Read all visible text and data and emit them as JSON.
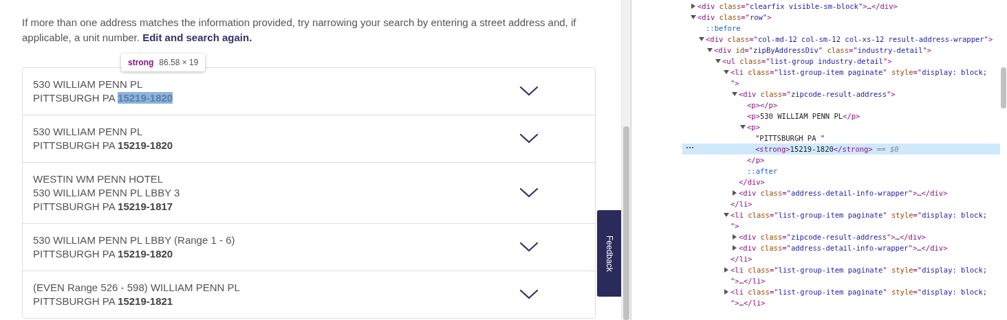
{
  "intro": {
    "text": "If more than one address matches the information provided, try narrowing your search by entering a street address and, if applicable, a unit number.",
    "link": "Edit and search again."
  },
  "inspector_tooltip": {
    "tag": "strong",
    "size": "86.58 × 19"
  },
  "results": [
    {
      "lines": [
        "530 WILLIAM PENN PL"
      ],
      "city": "PITTSBURGH PA",
      "zip": "15219-1820",
      "highlighted": true,
      "expanded": false
    },
    {
      "lines": [
        "530 WILLIAM PENN PL"
      ],
      "city": "PITTSBURGH PA",
      "zip": "15219-1820",
      "highlighted": false,
      "expanded": false
    },
    {
      "lines": [
        "WESTIN WM PENN HOTEL",
        "530 WILLIAM PENN PL LBBY 3"
      ],
      "city": "PITTSBURGH PA",
      "zip": "15219-1817",
      "highlighted": false,
      "expanded": false
    },
    {
      "lines": [
        "530 WILLIAM PENN PL LBBY (Range 1 - 6)"
      ],
      "city": "PITTSBURGH PA",
      "zip": "15219-1820",
      "highlighted": false,
      "expanded": false
    },
    {
      "lines": [
        "(EVEN Range 526 - 598) WILLIAM PENN PL"
      ],
      "city": "PITTSBURGH PA",
      "zip": "15219-1821",
      "highlighted": false,
      "expanded": false
    }
  ],
  "feedback_tab": "Feedback",
  "dom_tree": [
    {
      "expanded": false,
      "selected": false,
      "parts": [
        {
          "kind": "tag",
          "text": "<div "
        },
        {
          "kind": "attr",
          "text": "class"
        },
        {
          "kind": "tag",
          "text": "=\""
        },
        {
          "kind": "value",
          "text": "clearfix visible-sm-block"
        },
        {
          "kind": "tag",
          "text": "\">"
        },
        {
          "kind": "text",
          "text": "…"
        },
        {
          "kind": "tag",
          "text": "</div>"
        }
      ]
    },
    {
      "expanded": true,
      "selected": false,
      "parts": [
        {
          "kind": "tag",
          "text": "<div "
        },
        {
          "kind": "attr",
          "text": "class"
        },
        {
          "kind": "tag",
          "text": "=\""
        },
        {
          "kind": "value",
          "text": "row"
        },
        {
          "kind": "tag",
          "text": "\">"
        }
      ],
      "children": [
        {
          "selected": false,
          "parts": [
            {
              "kind": "pseudo",
              "text": "::before"
            }
          ]
        },
        {
          "expanded": true,
          "selected": false,
          "parts": [
            {
              "kind": "tag",
              "text": "<div "
            },
            {
              "kind": "attr",
              "text": "class"
            },
            {
              "kind": "tag",
              "text": "=\""
            },
            {
              "kind": "value",
              "text": "col-md-12 col-sm-12 col-xs-12 result-address-wrapper"
            },
            {
              "kind": "tag",
              "text": "\">"
            }
          ],
          "children": [
            {
              "expanded": true,
              "selected": false,
              "parts": [
                {
                  "kind": "tag",
                  "text": "<div "
                },
                {
                  "kind": "attr",
                  "text": "id"
                },
                {
                  "kind": "tag",
                  "text": "=\""
                },
                {
                  "kind": "value",
                  "text": "zipByAddressDiv"
                },
                {
                  "kind": "tag",
                  "text": "\" "
                },
                {
                  "kind": "attr",
                  "text": "class"
                },
                {
                  "kind": "tag",
                  "text": "=\""
                },
                {
                  "kind": "value",
                  "text": "industry-detail"
                },
                {
                  "kind": "tag",
                  "text": "\">"
                }
              ],
              "children": [
                {
                  "expanded": true,
                  "selected": false,
                  "parts": [
                    {
                      "kind": "tag",
                      "text": "<ul "
                    },
                    {
                      "kind": "attr",
                      "text": "class"
                    },
                    {
                      "kind": "tag",
                      "text": "=\""
                    },
                    {
                      "kind": "value",
                      "text": "list-group industry-detail"
                    },
                    {
                      "kind": "tag",
                      "text": "\">"
                    }
                  ],
                  "children": [
                    {
                      "expanded": true,
                      "selected": false,
                      "parts": [
                        {
                          "kind": "tag",
                          "text": "<li "
                        },
                        {
                          "kind": "attr",
                          "text": "class"
                        },
                        {
                          "kind": "tag",
                          "text": "=\""
                        },
                        {
                          "kind": "value",
                          "text": "list-group-item paginate"
                        },
                        {
                          "kind": "tag",
                          "text": "\" "
                        },
                        {
                          "kind": "attr",
                          "text": "style"
                        },
                        {
                          "kind": "tag",
                          "text": "=\""
                        },
                        {
                          "kind": "value",
                          "text": "display: block; "
                        },
                        {
                          "kind": "tag",
                          "text": "\">"
                        }
                      ],
                      "close": "</li>",
                      "children": [
                        {
                          "expanded": true,
                          "selected": false,
                          "parts": [
                            {
                              "kind": "tag",
                              "text": "<div "
                            },
                            {
                              "kind": "attr",
                              "text": "class"
                            },
                            {
                              "kind": "tag",
                              "text": "=\""
                            },
                            {
                              "kind": "value",
                              "text": "zipcode-result-address"
                            },
                            {
                              "kind": "tag",
                              "text": "\">"
                            }
                          ],
                          "close": "</div>",
                          "children": [
                            {
                              "selected": false,
                              "parts": [
                                {
                                  "kind": "tag",
                                  "text": "<p></p>"
                                }
                              ]
                            },
                            {
                              "selected": false,
                              "parts": [
                                {
                                  "kind": "tag",
                                  "text": "<p>"
                                },
                                {
                                  "kind": "text",
                                  "text": "530 WILLIAM PENN PL"
                                },
                                {
                                  "kind": "tag",
                                  "text": "</p>"
                                }
                              ]
                            },
                            {
                              "expanded": true,
                              "selected": false,
                              "parts": [
                                {
                                  "kind": "tag",
                                  "text": "<p>"
                                }
                              ],
                              "close": "</p>",
                              "children": [
                                {
                                  "selected": false,
                                  "parts": [
                                    {
                                      "kind": "text",
                                      "text": "\"PITTSBURGH PA \""
                                    }
                                  ]
                                },
                                {
                                  "selected": true,
                                  "parts": [
                                    {
                                      "kind": "tag",
                                      "text": "<strong>"
                                    },
                                    {
                                      "kind": "text",
                                      "text": "15219-1820"
                                    },
                                    {
                                      "kind": "tag",
                                      "text": "</strong>"
                                    },
                                    {
                                      "kind": "note",
                                      "text": " == $0"
                                    }
                                  ]
                                }
                              ]
                            },
                            {
                              "selected": false,
                              "parts": [
                                {
                                  "kind": "pseudo",
                                  "text": "::after"
                                }
                              ]
                            }
                          ]
                        },
                        {
                          "expanded": false,
                          "selected": false,
                          "parts": [
                            {
                              "kind": "tag",
                              "text": "<div "
                            },
                            {
                              "kind": "attr",
                              "text": "class"
                            },
                            {
                              "kind": "tag",
                              "text": "=\""
                            },
                            {
                              "kind": "value",
                              "text": "address-detail-info-wrapper"
                            },
                            {
                              "kind": "tag",
                              "text": "\">"
                            },
                            {
                              "kind": "text",
                              "text": "…"
                            },
                            {
                              "kind": "tag",
                              "text": "</div>"
                            }
                          ]
                        }
                      ]
                    },
                    {
                      "expanded": true,
                      "selected": false,
                      "parts": [
                        {
                          "kind": "tag",
                          "text": "<li "
                        },
                        {
                          "kind": "attr",
                          "text": "class"
                        },
                        {
                          "kind": "tag",
                          "text": "=\""
                        },
                        {
                          "kind": "value",
                          "text": "list-group-item paginate"
                        },
                        {
                          "kind": "tag",
                          "text": "\" "
                        },
                        {
                          "kind": "attr",
                          "text": "style"
                        },
                        {
                          "kind": "tag",
                          "text": "=\""
                        },
                        {
                          "kind": "value",
                          "text": "display: block; "
                        },
                        {
                          "kind": "tag",
                          "text": "\">"
                        }
                      ],
                      "close": "</li>",
                      "children": [
                        {
                          "expanded": false,
                          "selected": false,
                          "parts": [
                            {
                              "kind": "tag",
                              "text": "<div "
                            },
                            {
                              "kind": "attr",
                              "text": "class"
                            },
                            {
                              "kind": "tag",
                              "text": "=\""
                            },
                            {
                              "kind": "value",
                              "text": "zipcode-result-address"
                            },
                            {
                              "kind": "tag",
                              "text": "\">"
                            },
                            {
                              "kind": "text",
                              "text": "…"
                            },
                            {
                              "kind": "tag",
                              "text": "</div>"
                            }
                          ]
                        },
                        {
                          "expanded": false,
                          "selected": false,
                          "parts": [
                            {
                              "kind": "tag",
                              "text": "<div "
                            },
                            {
                              "kind": "attr",
                              "text": "class"
                            },
                            {
                              "kind": "tag",
                              "text": "=\""
                            },
                            {
                              "kind": "value",
                              "text": "address-detail-info-wrapper"
                            },
                            {
                              "kind": "tag",
                              "text": "\">"
                            },
                            {
                              "kind": "text",
                              "text": "…"
                            },
                            {
                              "kind": "tag",
                              "text": "</div>"
                            }
                          ]
                        }
                      ]
                    },
                    {
                      "expanded": false,
                      "selected": false,
                      "parts": [
                        {
                          "kind": "tag",
                          "text": "<li "
                        },
                        {
                          "kind": "attr",
                          "text": "class"
                        },
                        {
                          "kind": "tag",
                          "text": "=\""
                        },
                        {
                          "kind": "value",
                          "text": "list-group-item paginate"
                        },
                        {
                          "kind": "tag",
                          "text": "\" "
                        },
                        {
                          "kind": "attr",
                          "text": "style"
                        },
                        {
                          "kind": "tag",
                          "text": "=\""
                        },
                        {
                          "kind": "value",
                          "text": "display: block; "
                        },
                        {
                          "kind": "tag",
                          "text": "\">"
                        },
                        {
                          "kind": "text",
                          "text": "…"
                        },
                        {
                          "kind": "tag",
                          "text": "</li>"
                        }
                      ]
                    },
                    {
                      "expanded": false,
                      "selected": false,
                      "parts": [
                        {
                          "kind": "tag",
                          "text": "<li "
                        },
                        {
                          "kind": "attr",
                          "text": "class"
                        },
                        {
                          "kind": "tag",
                          "text": "=\""
                        },
                        {
                          "kind": "value",
                          "text": "list-group-item paginate"
                        },
                        {
                          "kind": "tag",
                          "text": "\" "
                        },
                        {
                          "kind": "attr",
                          "text": "style"
                        },
                        {
                          "kind": "tag",
                          "text": "=\""
                        },
                        {
                          "kind": "value",
                          "text": "display: block; "
                        },
                        {
                          "kind": "tag",
                          "text": "\">"
                        },
                        {
                          "kind": "text",
                          "text": "…"
                        },
                        {
                          "kind": "tag",
                          "text": "</li>"
                        }
                      ]
                    }
                  ]
                }
              ]
            }
          ]
        }
      ]
    }
  ]
}
